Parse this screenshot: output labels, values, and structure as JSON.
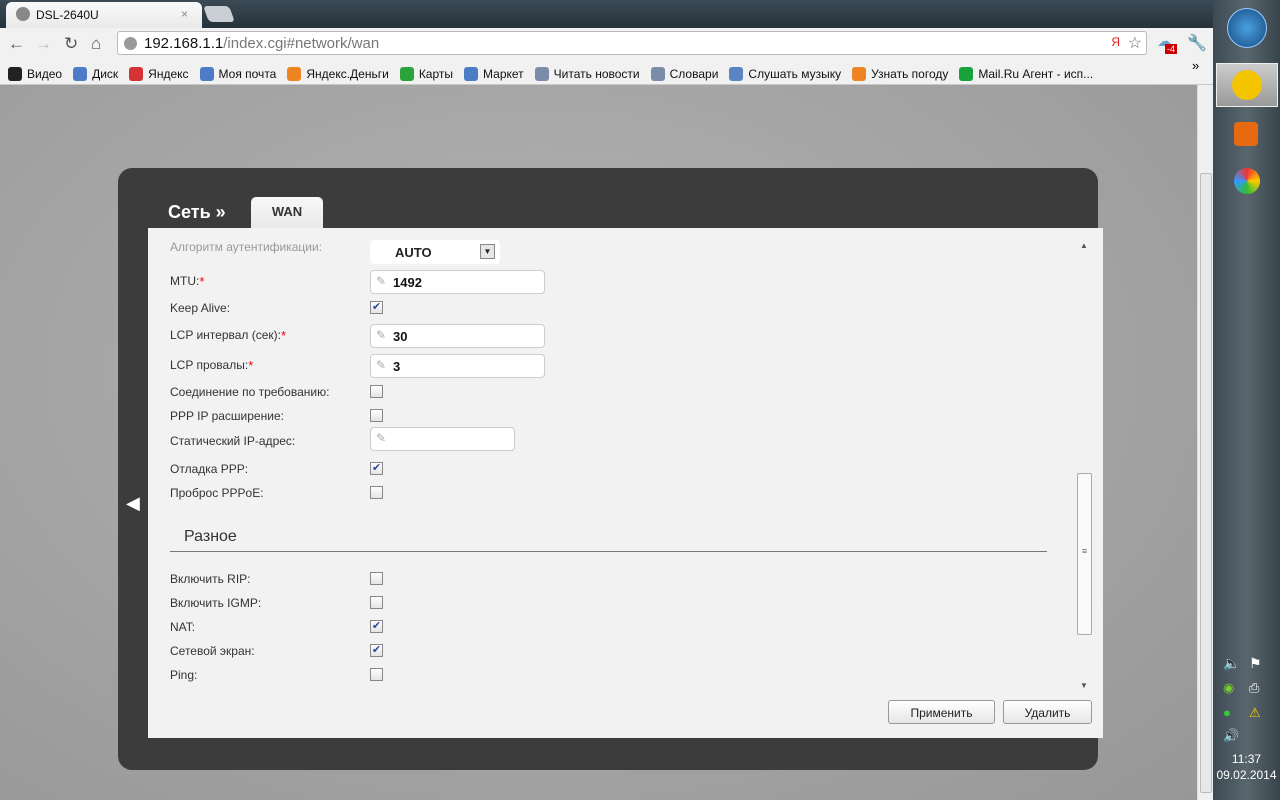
{
  "browser": {
    "tab_title": "DSL-2640U",
    "url_host": "192.168.1.1",
    "url_path": "/index.cgi#network/wan",
    "ext_badge": "-4",
    "bookmarks": [
      "Видео",
      "Диск",
      "Яндекс",
      "Моя почта",
      "Яндекс.Деньги",
      "Карты",
      "Маркет",
      "Читать новости",
      "Словари",
      "Слушать музыку",
      "Узнать погоду",
      "Mail.Ru Агент - исп..."
    ],
    "bookmark_colors": [
      "#222222",
      "#4d7cc6",
      "#d33333",
      "#4d7cc6",
      "#ee8522",
      "#2aa43a",
      "#4d7cc6",
      "#7a8ca8",
      "#7a8ca8",
      "#5a84c4",
      "#ee8522",
      "#18a23b"
    ],
    "more": "»"
  },
  "page": {
    "breadcrumb": "Сеть »",
    "tab": "WAN",
    "auth_label": "Алгоритм аутентификации:",
    "auth_value": "AUTO",
    "fields": [
      {
        "label": "MTU:",
        "req": "*",
        "value": "1492"
      },
      {
        "label": "LCP интервал (сек):",
        "req": "*",
        "value": "30"
      },
      {
        "label": "LCP провалы:",
        "req": "*",
        "value": "3"
      },
      {
        "label": "Статический IP-адрес:",
        "value": ""
      }
    ],
    "checks": [
      {
        "label": "Keep Alive:",
        "checked": true
      },
      {
        "label": "Соединение по требованию:",
        "checked": false
      },
      {
        "label": "PPP IP расширение:",
        "checked": false
      },
      {
        "label": "Отладка PPP:",
        "checked": true
      },
      {
        "label": "Проброс PPPoE:",
        "checked": false
      }
    ],
    "misc_heading": "Разное",
    "misc": [
      {
        "label": "Включить RIP:",
        "checked": false
      },
      {
        "label": "Включить IGMP:",
        "checked": false
      },
      {
        "label": "NAT:",
        "checked": true
      },
      {
        "label": "Сетевой экран:",
        "checked": true
      },
      {
        "label": "Ping:",
        "checked": false
      }
    ],
    "apply": "Применить",
    "delete": "Удалить"
  },
  "taskbar": {
    "time": "11:37",
    "date": "09.02.2014"
  }
}
